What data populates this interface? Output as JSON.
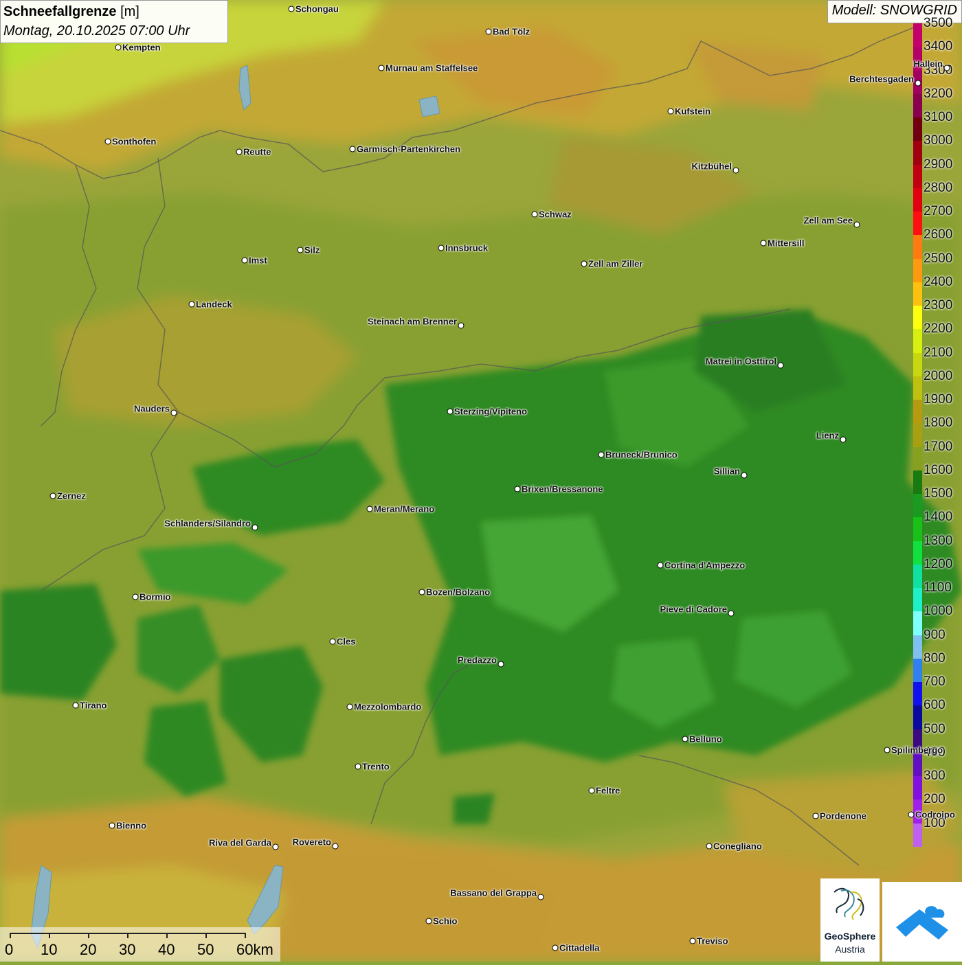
{
  "map": {
    "title_bold": "Schneefallgrenze",
    "title_unit": "[m]",
    "datetime": "Montag, 20.10.2025 07:00 Uhr",
    "model": "Modell: SNOWGRID"
  },
  "legend": {
    "levels": [
      {
        "label": "3500",
        "color": "#c4006a"
      },
      {
        "label": "3400",
        "color": "#b30066"
      },
      {
        "label": "3300",
        "color": "#a00060"
      },
      {
        "label": "3200",
        "color": "#88004e"
      },
      {
        "label": "3100",
        "color": "#700010"
      },
      {
        "label": "3000",
        "color": "#a00010"
      },
      {
        "label": "2900",
        "color": "#c00010"
      },
      {
        "label": "2800",
        "color": "#e00010"
      },
      {
        "label": "2700",
        "color": "#ff1010"
      },
      {
        "label": "2600",
        "color": "#ff7a10"
      },
      {
        "label": "2500",
        "color": "#ff9a10"
      },
      {
        "label": "2400",
        "color": "#ffc010"
      },
      {
        "label": "2300",
        "color": "#ffff10"
      },
      {
        "label": "2200",
        "color": "#d8f010"
      },
      {
        "label": "2100",
        "color": "#c8d810"
      },
      {
        "label": "2000",
        "color": "#c0c010"
      },
      {
        "label": "1900",
        "color": "#b89a10"
      },
      {
        "label": "1800",
        "color": "#a8a010"
      },
      {
        "label": "1700",
        "color": "#88a020"
      },
      {
        "label": "1600",
        "color": "#187a10"
      },
      {
        "label": "1500",
        "color": "#1a9a20"
      },
      {
        "label": "1400",
        "color": "#18c018"
      },
      {
        "label": "1300",
        "color": "#10e040"
      },
      {
        "label": "1200",
        "color": "#10e0a0"
      },
      {
        "label": "1100",
        "color": "#20f0c8"
      },
      {
        "label": "1000",
        "color": "#80ffff"
      },
      {
        "label": "900",
        "color": "#80c0f0"
      },
      {
        "label": "800",
        "color": "#3080f0"
      },
      {
        "label": "700",
        "color": "#1010f0"
      },
      {
        "label": "600",
        "color": "#0a0aa0"
      },
      {
        "label": "500",
        "color": "#3a0a80"
      },
      {
        "label": "400",
        "color": "#6010c0"
      },
      {
        "label": "300",
        "color": "#8010e0"
      },
      {
        "label": "200",
        "color": "#a020e8"
      },
      {
        "label": "100",
        "color": "#c060f0"
      }
    ]
  },
  "cities": [
    {
      "name": "Schongau",
      "side": "right"
    },
    {
      "name": "Bad Tölz",
      "side": "right"
    },
    {
      "name": "Kempten",
      "side": "right"
    },
    {
      "name": "Murnau am Staffelsee",
      "side": "right"
    },
    {
      "name": "Hallein",
      "side": "left"
    },
    {
      "name": "Berchtesgaden",
      "side": "left"
    },
    {
      "name": "Kufstein",
      "side": "right"
    },
    {
      "name": "Sonthofen",
      "side": "right"
    },
    {
      "name": "Reutte",
      "side": "right"
    },
    {
      "name": "Garmisch-Partenkirchen",
      "side": "right"
    },
    {
      "name": "Kitzbühel",
      "side": "left"
    },
    {
      "name": "Schwaz",
      "side": "right"
    },
    {
      "name": "Zell am See",
      "side": "left"
    },
    {
      "name": "Mittersill",
      "side": "right"
    },
    {
      "name": "Innsbruck",
      "side": "right"
    },
    {
      "name": "Imst",
      "side": "right"
    },
    {
      "name": "Silz",
      "side": "right"
    },
    {
      "name": "Zell am Ziller",
      "side": "right"
    },
    {
      "name": "Landeck",
      "side": "right"
    },
    {
      "name": "Steinach am Brenner",
      "side": "left"
    },
    {
      "name": "Matrei in Osttirol",
      "side": "left"
    },
    {
      "name": "Nauders",
      "side": "left"
    },
    {
      "name": "Sterzing/Vipiteno",
      "side": "right"
    },
    {
      "name": "Lienz",
      "side": "left"
    },
    {
      "name": "Bruneck/Brunico",
      "side": "right"
    },
    {
      "name": "Sillian",
      "side": "left"
    },
    {
      "name": "Zernez",
      "side": "right"
    },
    {
      "name": "Brixen/Bressanone",
      "side": "right"
    },
    {
      "name": "Meran/Merano",
      "side": "right"
    },
    {
      "name": "Schlanders/Silandro",
      "side": "left"
    },
    {
      "name": "Cortina d'Ampezzo",
      "side": "right"
    },
    {
      "name": "Bozen/Bolzano",
      "side": "right"
    },
    {
      "name": "Bormio",
      "side": "right"
    },
    {
      "name": "Pieve di Cadore",
      "side": "left"
    },
    {
      "name": "Cles",
      "side": "right"
    },
    {
      "name": "Predazzo",
      "side": "left"
    },
    {
      "name": "Tirano",
      "side": "right"
    },
    {
      "name": "Mezzolombardo",
      "side": "right"
    },
    {
      "name": "Belluno",
      "side": "right"
    },
    {
      "name": "Spilimbergo",
      "side": "right"
    },
    {
      "name": "Trento",
      "side": "right"
    },
    {
      "name": "Feltre",
      "side": "right"
    },
    {
      "name": "Pordenone",
      "side": "right"
    },
    {
      "name": "Bienno",
      "side": "right"
    },
    {
      "name": "Riva del Garda",
      "side": "left"
    },
    {
      "name": "Rovereto",
      "side": "left"
    },
    {
      "name": "Conegliano",
      "side": "right"
    },
    {
      "name": "Bassano del Grappa",
      "side": "left"
    },
    {
      "name": "Schio",
      "side": "right"
    },
    {
      "name": "Treviso",
      "side": "right"
    },
    {
      "name": "Cittadella",
      "side": "right"
    },
    {
      "name": "Codroipo",
      "side": "right"
    }
  ],
  "scale": {
    "ticks": [
      "0",
      "10",
      "20",
      "30",
      "40",
      "50",
      "60km"
    ]
  },
  "logos": {
    "geosphere_line1": "GeoSphere",
    "geosphere_line2": "Austria"
  }
}
